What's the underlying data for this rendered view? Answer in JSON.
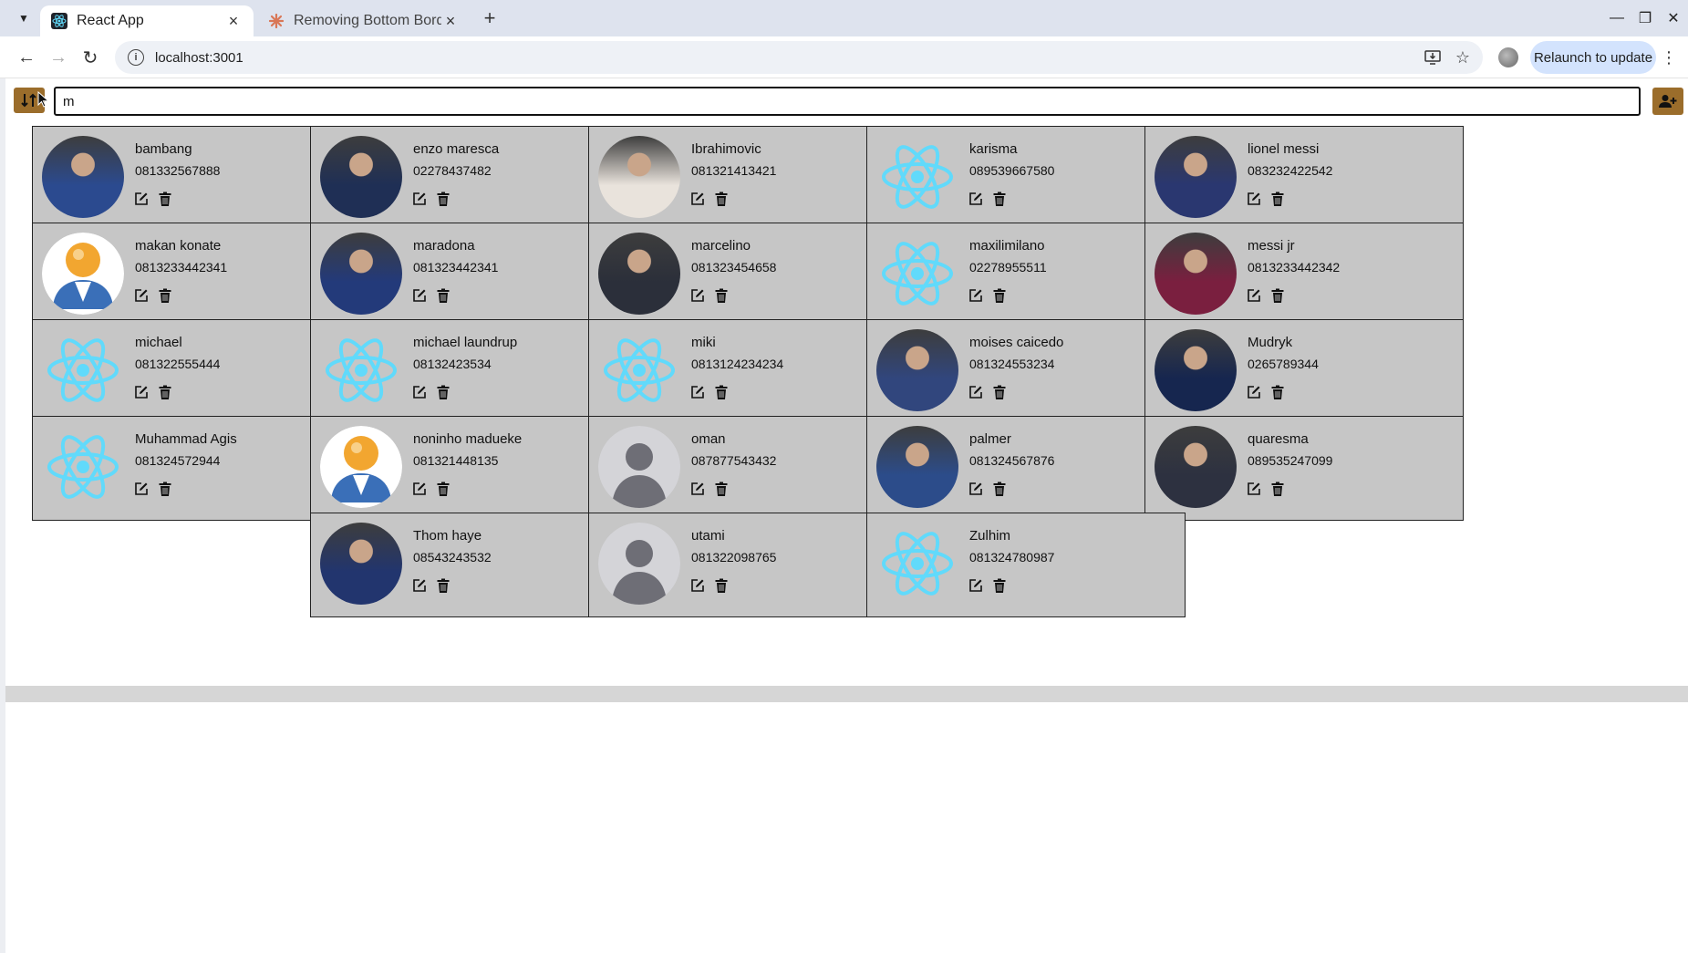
{
  "browser": {
    "tabs": [
      {
        "title": "React App",
        "active": true
      },
      {
        "title": "Removing Bottom Borde",
        "active": false
      }
    ],
    "url": "localhost:3001",
    "relaunch_label": "Relaunch to update"
  },
  "search": {
    "value": "m"
  },
  "colors": {
    "accent": "#9b6d2b",
    "card_bg": "#c6c6c6"
  },
  "contacts": [
    {
      "name": "bambang",
      "phone": "081332567888",
      "avatar": "photo"
    },
    {
      "name": "enzo maresca",
      "phone": "02278437482",
      "avatar": "photo"
    },
    {
      "name": "Ibrahimovic",
      "phone": "081321413421",
      "avatar": "photo"
    },
    {
      "name": "karisma",
      "phone": "089539667580",
      "avatar": "react-logo"
    },
    {
      "name": "lionel messi",
      "phone": "083232422542",
      "avatar": "photo"
    },
    {
      "name": "makan konate",
      "phone": "0813233442341",
      "avatar": "user-icon"
    },
    {
      "name": "maradona",
      "phone": "081323442341",
      "avatar": "photo"
    },
    {
      "name": "marcelino",
      "phone": "081323454658",
      "avatar": "photo"
    },
    {
      "name": "maxilimilano",
      "phone": "02278955511",
      "avatar": "react-logo"
    },
    {
      "name": "messi jr",
      "phone": "0813233442342",
      "avatar": "photo"
    },
    {
      "name": "michael",
      "phone": "081322555444",
      "avatar": "react-logo"
    },
    {
      "name": "michael laundrup",
      "phone": "08132423534",
      "avatar": "react-logo"
    },
    {
      "name": "miki",
      "phone": "0813124234234",
      "avatar": "react-logo"
    },
    {
      "name": "moises caicedo",
      "phone": "081324553234",
      "avatar": "photo"
    },
    {
      "name": "Mudryk",
      "phone": "0265789344",
      "avatar": "photo"
    },
    {
      "name": "Muhammad Agis",
      "phone": "081324572944",
      "avatar": "react-logo"
    },
    {
      "name": "noninho madueke",
      "phone": "081321448135",
      "avatar": "user-icon"
    },
    {
      "name": "oman",
      "phone": "087877543432",
      "avatar": "placeholder"
    },
    {
      "name": "palmer",
      "phone": "081324567876",
      "avatar": "photo"
    },
    {
      "name": "quaresma",
      "phone": "089535247099",
      "avatar": "photo"
    },
    {
      "name": "Thom haye",
      "phone": "08543243532",
      "avatar": "photo"
    },
    {
      "name": "utami",
      "phone": "081322098765",
      "avatar": "placeholder"
    },
    {
      "name": "Zulhim",
      "phone": "081324780987",
      "avatar": "react-logo"
    }
  ]
}
